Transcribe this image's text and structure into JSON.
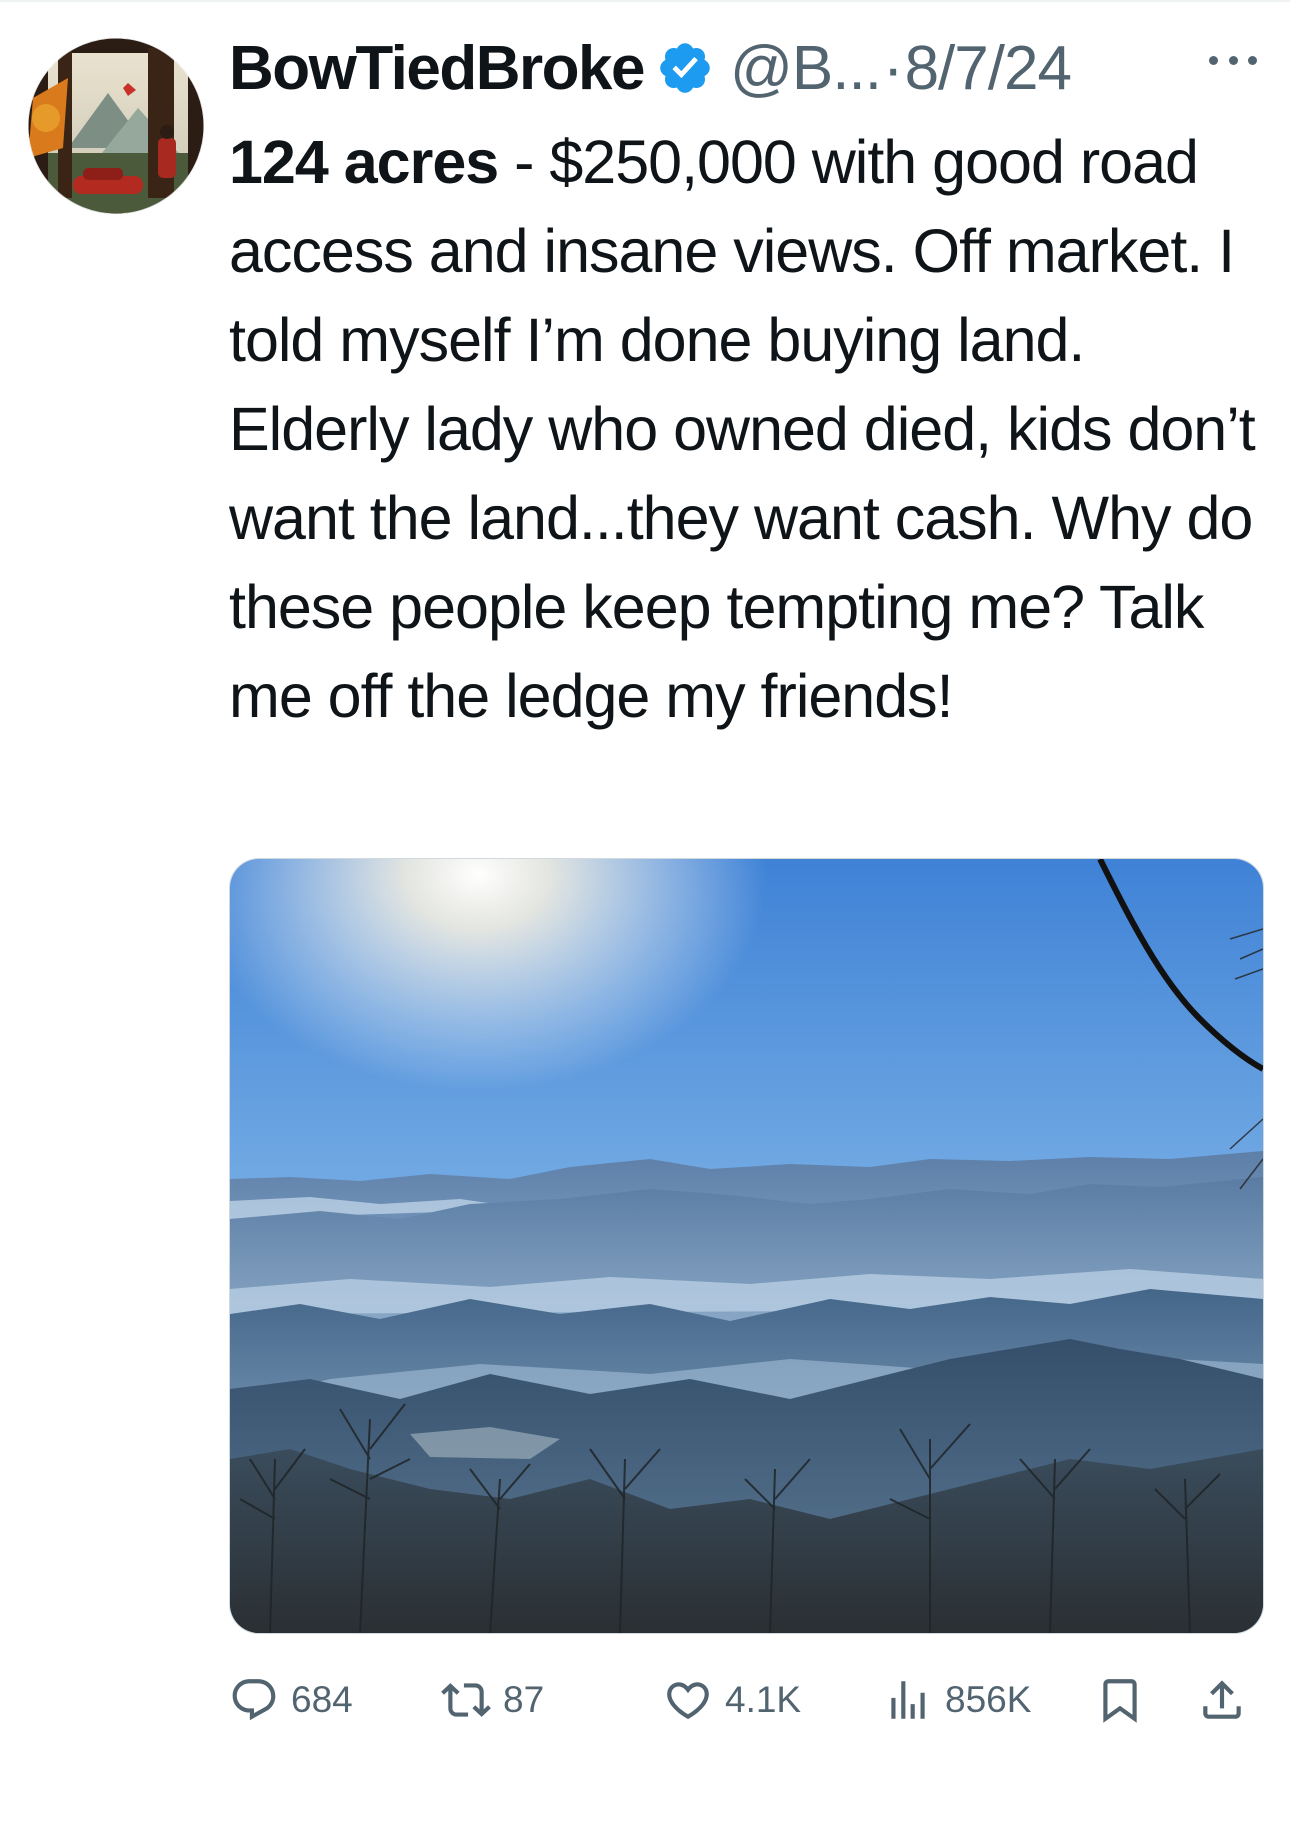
{
  "tweet": {
    "display_name": "BowTiedBroke",
    "handle": "@B...",
    "separator": "·",
    "date": "8/7/24",
    "text_bold": "124 acres",
    "text_rest": " - $250,000 with good road access and insane views. Off market. I told myself I’m done buying land. Elderly lady who owned died, kids don’t want the land...they want cash. Why do these people keep tempting me? Talk me off the ledge my friends!"
  },
  "stats": {
    "replies": "684",
    "reposts": "87",
    "likes": "4.1K",
    "views": "856K"
  },
  "icons": [
    "more-icon",
    "verified-badge-icon",
    "reply-icon",
    "retweet-icon",
    "like-icon",
    "views-icon",
    "bookmark-icon",
    "share-icon"
  ],
  "colors": {
    "verified": "#1d9bf0",
    "secondary_text": "#536471",
    "primary_text": "#0f1419"
  }
}
